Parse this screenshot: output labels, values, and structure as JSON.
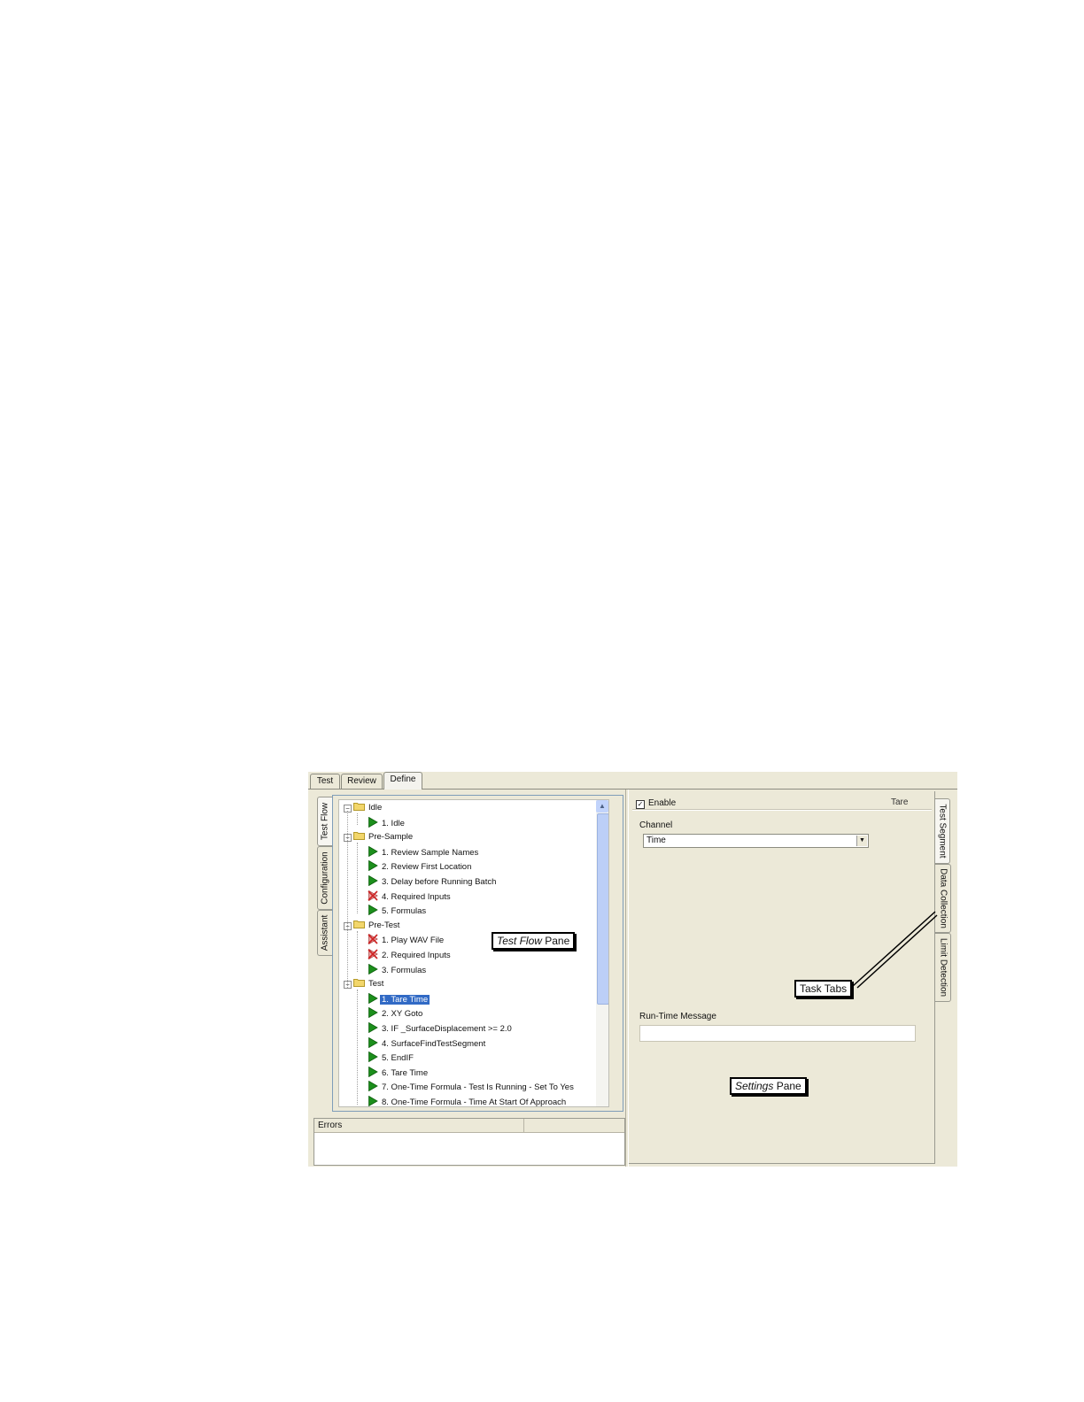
{
  "top_tabs": [
    {
      "label": "Test",
      "active": false
    },
    {
      "label": "Review",
      "active": false
    },
    {
      "label": "Define",
      "active": true
    }
  ],
  "left_tabs": [
    {
      "label": "Test Flow",
      "active": true
    },
    {
      "label": "Configuration",
      "active": false
    },
    {
      "label": "Assistant",
      "active": false
    }
  ],
  "tree": {
    "groups": [
      {
        "label": "Idle",
        "items": [
          {
            "label": "1. Idle",
            "status": "ok"
          }
        ]
      },
      {
        "label": "Pre-Sample",
        "items": [
          {
            "label": "1. Review Sample Names",
            "status": "ok"
          },
          {
            "label": "2. Review First Location",
            "status": "ok"
          },
          {
            "label": "3. Delay before Running Batch",
            "status": "ok"
          },
          {
            "label": "4. Required Inputs",
            "status": "disabled"
          },
          {
            "label": "5. Formulas",
            "status": "ok"
          }
        ]
      },
      {
        "label": "Pre-Test",
        "items": [
          {
            "label": "1. Play WAV File",
            "status": "disabled"
          },
          {
            "label": "2. Required Inputs",
            "status": "disabled"
          },
          {
            "label": "3. Formulas",
            "status": "ok"
          }
        ]
      },
      {
        "label": "Test",
        "items": [
          {
            "label": "1. Tare Time",
            "status": "ok",
            "selected": true
          },
          {
            "label": "2. XY Goto",
            "status": "ok"
          },
          {
            "label": "3. IF _SurfaceDisplacement >= 2.0",
            "status": "ok"
          },
          {
            "label": "4.    SurfaceFindTestSegment",
            "status": "ok"
          },
          {
            "label": "5. EndIF",
            "status": "ok"
          },
          {
            "label": "6. Tare Time",
            "status": "ok"
          },
          {
            "label": "7. One-Time Formula - Test Is Running - Set To Yes",
            "status": "ok"
          },
          {
            "label": "8. One-Time Formula - Time At Start Of Approach",
            "status": "ok"
          }
        ]
      }
    ]
  },
  "errors": {
    "header": "Errors"
  },
  "settings": {
    "enable_label": "Enable",
    "enable_checked": true,
    "tare_label": "Tare",
    "channel_label": "Channel",
    "channel_value": "Time",
    "runtime_message_label": "Run-Time Message",
    "runtime_message_value": ""
  },
  "right_tabs": [
    {
      "label": "Test Segment",
      "active": true
    },
    {
      "label": "Data Collection",
      "active": false
    },
    {
      "label": "Limit Detection",
      "active": false
    }
  ],
  "callouts": {
    "test_flow_pane": {
      "italic": "Test Flow",
      "rest": " Pane"
    },
    "settings_pane": {
      "italic": "Settings",
      "rest": " Pane"
    },
    "task_tabs": "Task Tabs"
  },
  "colors": {
    "play_icon": "#1c8f1c",
    "disabled_icon": "#cc2222",
    "folder_icon": "#f2d66b",
    "selection": "#316ac5",
    "panel_bg": "#ece9d8"
  }
}
